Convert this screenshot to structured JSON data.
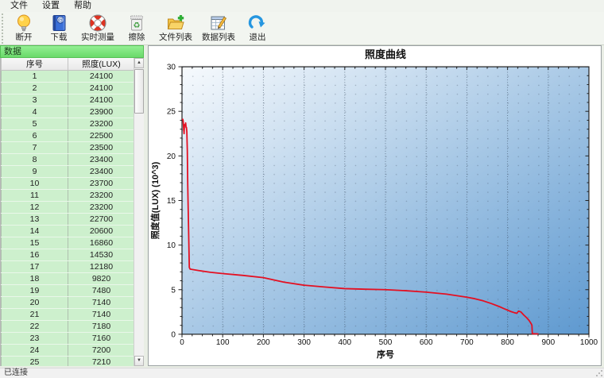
{
  "menu": {
    "items": [
      {
        "label": "文件"
      },
      {
        "label": "设置"
      },
      {
        "label": "帮助"
      }
    ]
  },
  "toolbar": {
    "buttons": [
      {
        "label": "断开",
        "icon": "bulb-icon"
      },
      {
        "label": "下载",
        "icon": "book-at-icon"
      },
      {
        "label": "实时测量",
        "icon": "lifebuoy-icon"
      },
      {
        "label": "擦除",
        "icon": "recycle-bin-icon"
      },
      {
        "label": "文件列表",
        "icon": "folder-plus-icon"
      },
      {
        "label": "数据列表",
        "icon": "table-pencil-icon"
      },
      {
        "label": "退出",
        "icon": "exit-arrow-icon"
      }
    ]
  },
  "sidebar": {
    "title": "数据",
    "columns": [
      "序号",
      "照度(LUX)"
    ],
    "rows": [
      [
        1,
        24100
      ],
      [
        2,
        24100
      ],
      [
        3,
        24100
      ],
      [
        4,
        23900
      ],
      [
        5,
        23200
      ],
      [
        6,
        22500
      ],
      [
        7,
        23500
      ],
      [
        8,
        23400
      ],
      [
        9,
        23400
      ],
      [
        10,
        23700
      ],
      [
        11,
        23200
      ],
      [
        12,
        23200
      ],
      [
        13,
        22700
      ],
      [
        14,
        20600
      ],
      [
        15,
        16860
      ],
      [
        16,
        14530
      ],
      [
        17,
        12180
      ],
      [
        18,
        9820
      ],
      [
        19,
        7480
      ],
      [
        20,
        7140
      ],
      [
        21,
        7140
      ],
      [
        22,
        7180
      ],
      [
        23,
        7160
      ],
      [
        24,
        7200
      ],
      [
        25,
        7210
      ]
    ]
  },
  "chart_data": {
    "type": "line",
    "title": "照度曲线",
    "xlabel": "序号",
    "ylabel": "照度值(LUX) (10^3)",
    "xlim": [
      0,
      1000
    ],
    "ylim": [
      0,
      30
    ],
    "xticks": [
      0,
      100,
      200,
      300,
      400,
      500,
      600,
      700,
      800,
      900,
      1000
    ],
    "yticks": [
      0,
      5,
      10,
      15,
      20,
      25,
      30
    ],
    "x_minor_step": 25,
    "y_minor_step": 1,
    "grid": "dotted",
    "plot_gradient": [
      "#f7fafd",
      "#a9c9e6",
      "#5e99d0"
    ],
    "series": [
      {
        "name": "照度",
        "color": "#e41022",
        "points": [
          [
            0,
            24.1
          ],
          [
            1,
            24.1
          ],
          [
            2,
            24.1
          ],
          [
            3,
            23.9
          ],
          [
            4,
            23.2
          ],
          [
            5,
            22.5
          ],
          [
            6,
            23.5
          ],
          [
            7,
            23.4
          ],
          [
            8,
            23.4
          ],
          [
            9,
            23.7
          ],
          [
            10,
            23.2
          ],
          [
            11,
            23.2
          ],
          [
            12,
            22.7
          ],
          [
            13,
            20.6
          ],
          [
            14,
            16.9
          ],
          [
            15,
            14.5
          ],
          [
            16,
            12.2
          ],
          [
            17,
            9.8
          ],
          [
            18,
            7.5
          ],
          [
            20,
            7.3
          ],
          [
            40,
            7.15
          ],
          [
            70,
            6.95
          ],
          [
            100,
            6.8
          ],
          [
            150,
            6.6
          ],
          [
            200,
            6.35
          ],
          [
            250,
            5.85
          ],
          [
            300,
            5.5
          ],
          [
            350,
            5.3
          ],
          [
            400,
            5.12
          ],
          [
            450,
            5.05
          ],
          [
            500,
            5.0
          ],
          [
            550,
            4.88
          ],
          [
            600,
            4.72
          ],
          [
            650,
            4.5
          ],
          [
            700,
            4.15
          ],
          [
            720,
            3.98
          ],
          [
            740,
            3.75
          ],
          [
            760,
            3.45
          ],
          [
            780,
            3.1
          ],
          [
            795,
            2.8
          ],
          [
            808,
            2.55
          ],
          [
            818,
            2.4
          ],
          [
            823,
            2.35
          ],
          [
            827,
            2.6
          ],
          [
            833,
            2.5
          ],
          [
            840,
            2.15
          ],
          [
            847,
            1.85
          ],
          [
            853,
            1.55
          ],
          [
            858,
            1.2
          ],
          [
            860,
            1.0
          ],
          [
            861,
            0.06
          ],
          [
            876,
            0.04
          ]
        ]
      }
    ]
  },
  "statusbar": {
    "text": "已连接"
  }
}
